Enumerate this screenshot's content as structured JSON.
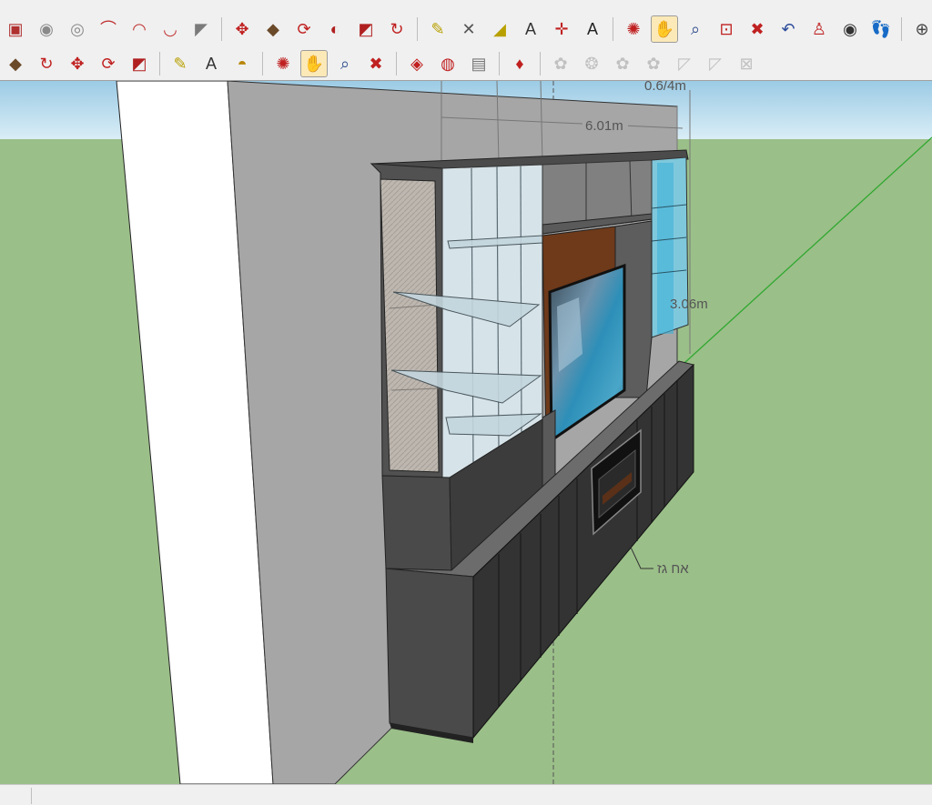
{
  "toolbar_top": {
    "tools": [
      {
        "icon": "pencil-icon"
      },
      {
        "icon": "line-icon"
      },
      {
        "icon": "freehand-icon"
      },
      {
        "icon": "pushpull-small-icon"
      },
      {
        "icon": "shape-icon"
      },
      {
        "icon": "cube-icon"
      },
      {
        "icon": "building-icon"
      },
      {
        "icon": "box-outline-icon"
      },
      {
        "icon": "box-outline-icon"
      },
      {
        "icon": "box-outline-icon"
      }
    ]
  },
  "toolbar_1": {
    "groups": [
      [
        {
          "icon": "rectangle-icon",
          "glyph": "▣",
          "color": "#b03030"
        },
        {
          "icon": "circle-icon",
          "glyph": "◉",
          "color": "#8a8a8a"
        },
        {
          "icon": "polygon-icon",
          "glyph": "◎",
          "color": "#8a8a8a"
        },
        {
          "icon": "arc-icon",
          "glyph": "⌒",
          "color": "#c03030"
        },
        {
          "icon": "arc-2pt-icon",
          "glyph": "◠",
          "color": "#c03030"
        },
        {
          "icon": "arc-3pt-icon",
          "glyph": "◡",
          "color": "#c03030"
        },
        {
          "icon": "pie-icon",
          "glyph": "◤",
          "color": "#7a7a7a"
        }
      ],
      [
        {
          "icon": "move-icon",
          "glyph": "✥",
          "color": "#c02020"
        },
        {
          "icon": "push-pull-icon",
          "glyph": "◆",
          "color": "#6b4a2a"
        },
        {
          "icon": "rotate-icon",
          "glyph": "⟳",
          "color": "#c02020"
        },
        {
          "icon": "follow-me-icon",
          "glyph": "◐",
          "color": "#b02020"
        },
        {
          "icon": "scale-icon",
          "glyph": "◩",
          "color": "#b02020"
        },
        {
          "icon": "offset-icon",
          "glyph": "↻",
          "color": "#c02020"
        }
      ],
      [
        {
          "icon": "tape-measure-icon",
          "glyph": "✎",
          "color": "#b8a000"
        },
        {
          "icon": "dimension-icon",
          "glyph": "✕",
          "color": "#555555"
        },
        {
          "icon": "protractor-icon",
          "glyph": "◢",
          "color": "#b8a000"
        },
        {
          "icon": "text-icon",
          "glyph": "A",
          "color": "#333333"
        },
        {
          "icon": "axes-icon",
          "glyph": "✛",
          "color": "#c02020"
        },
        {
          "icon": "3d-text-icon",
          "glyph": "A",
          "color": "#222222"
        }
      ],
      [
        {
          "icon": "orbit-icon",
          "glyph": "✺",
          "color": "#c02020"
        },
        {
          "icon": "pan-icon",
          "glyph": "✋",
          "color": "#b88a40",
          "active": true
        },
        {
          "icon": "zoom-icon",
          "glyph": "⌕",
          "color": "#2a4a8a"
        },
        {
          "icon": "zoom-window-icon",
          "glyph": "⊡",
          "color": "#c02020"
        },
        {
          "icon": "zoom-extents-icon",
          "glyph": "✖",
          "color": "#c02020"
        },
        {
          "icon": "previous-view-icon",
          "glyph": "↶",
          "color": "#2a4a9a"
        },
        {
          "icon": "position-camera-icon",
          "glyph": "♙",
          "color": "#c02020"
        },
        {
          "icon": "look-around-icon",
          "glyph": "◉",
          "color": "#333333"
        },
        {
          "icon": "walk-icon",
          "glyph": "👣",
          "color": "#333333"
        }
      ],
      [
        {
          "icon": "section-plane-icon",
          "glyph": "⊕",
          "color": "#444444"
        }
      ]
    ]
  },
  "toolbar_2": {
    "groups": [
      [
        {
          "icon": "push-pull-icon",
          "glyph": "◆",
          "color": "#6b4a2a"
        },
        {
          "icon": "offset-icon",
          "glyph": "↻",
          "color": "#c02020"
        },
        {
          "icon": "move-icon",
          "glyph": "✥",
          "color": "#c02020"
        },
        {
          "icon": "rotate-icon",
          "glyph": "⟳",
          "color": "#c02020"
        },
        {
          "icon": "scale-icon",
          "glyph": "◩",
          "color": "#b02020"
        }
      ],
      [
        {
          "icon": "tape-measure-icon",
          "glyph": "✎",
          "color": "#b8a000"
        },
        {
          "icon": "text-icon",
          "glyph": "A",
          "color": "#333333"
        },
        {
          "icon": "paint-bucket-icon",
          "glyph": "◓",
          "color": "#b8860b"
        }
      ],
      [
        {
          "icon": "orbit-icon",
          "glyph": "✺",
          "color": "#c02020"
        },
        {
          "icon": "pan-icon",
          "glyph": "✋",
          "color": "#b88a40",
          "active": true
        },
        {
          "icon": "zoom-icon",
          "glyph": "⌕",
          "color": "#2a4a8a"
        },
        {
          "icon": "zoom-extents-icon",
          "glyph": "✖",
          "color": "#c02020"
        }
      ],
      [
        {
          "icon": "components-icon",
          "glyph": "◈",
          "color": "#c02020"
        },
        {
          "icon": "materials-icon",
          "glyph": "◍",
          "color": "#c02020"
        },
        {
          "icon": "3d-warehouse-icon",
          "glyph": "▤",
          "color": "#777777"
        }
      ],
      [
        {
          "icon": "ruby-icon",
          "glyph": "♦",
          "color": "#c02020"
        }
      ],
      [
        {
          "icon": "sandbox-from-contours-icon",
          "glyph": "✿",
          "color": "#8a8a8a",
          "dim": true
        },
        {
          "icon": "sandbox-from-scratch-icon",
          "glyph": "❂",
          "color": "#8a8a8a",
          "dim": true
        },
        {
          "icon": "sandbox-smoove-icon",
          "glyph": "✿",
          "color": "#8a8a8a",
          "dim": true
        },
        {
          "icon": "sandbox-stamp-icon",
          "glyph": "✿",
          "color": "#8a8a8a",
          "dim": true
        },
        {
          "icon": "sandbox-drape-icon",
          "glyph": "◸",
          "color": "#8a8a8a",
          "dim": true
        },
        {
          "icon": "sandbox-add-detail-icon",
          "glyph": "◸",
          "color": "#8a8a8a",
          "dim": true
        },
        {
          "icon": "sandbox-flip-edge-icon",
          "glyph": "⊠",
          "color": "#8a8a8a",
          "dim": true
        }
      ]
    ]
  },
  "viewport": {
    "dimensions": {
      "width_label": "6.01m",
      "height_label": "3.06m",
      "top_label": "0.6/4m"
    },
    "annotation": {
      "label": "אח גז"
    },
    "colors": {
      "sky": "#cfe6f3",
      "ground": "#9bbf89",
      "wall": "#a4a4a4",
      "cabinet": "#4a4a4a",
      "wood": "#6e3a1a"
    }
  },
  "statusbar": {
    "text": ""
  }
}
